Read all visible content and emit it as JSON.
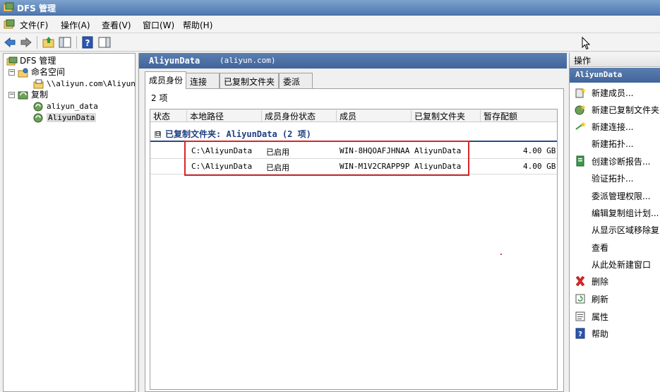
{
  "window": {
    "title": "DFS 管理",
    "icon": "dfs-management-icon"
  },
  "menu": [
    "文件(F)",
    "操作(A)",
    "查看(V)",
    "窗口(W)",
    "帮助(H)"
  ],
  "toolbar": {
    "buttons": [
      "back-arrow-icon",
      "forward-arrow-icon",
      "up-folder-icon",
      "show-hide-tree-icon",
      "help-icon",
      "action-pane-icon"
    ]
  },
  "tree": {
    "root": "DFS 管理",
    "namespace": "命名空间",
    "namespace_item": "\\\\aliyun.com\\AliyunDa",
    "replication": "复制",
    "groups": [
      "aliyun_data",
      "AliyunData"
    ]
  },
  "center": {
    "header_title": "AliyunData",
    "header_domain": "(aliyun.com)",
    "tabs": [
      "成员身份",
      "连接",
      "已复制文件夹",
      "委派"
    ],
    "count_text": "2 项",
    "columns": [
      "状态",
      "本地路径",
      "成员身份状态",
      "成员",
      "已复制文件夹",
      "暂存配额"
    ],
    "group_label": "已复制文件夹: AliyunData (2 项)",
    "group_toggle": "⊟",
    "rows": [
      {
        "status": "",
        "path": "C:\\AliyunData",
        "state": "已启用",
        "member": "WIN-8HQOAFJHNAA",
        "folder": "AliyunData",
        "quota": "4.00 GB"
      },
      {
        "status": "",
        "path": "C:\\AliyunData",
        "state": "已启用",
        "member": "WIN-M1V2CRAPP9P",
        "folder": "AliyunData",
        "quota": "4.00 GB"
      }
    ]
  },
  "actions": {
    "title": "操作",
    "subtitle": "AliyunData",
    "items": [
      {
        "label": "新建成员...",
        "icon": "new-member-icon"
      },
      {
        "label": "新建已复制文件夹",
        "icon": "new-replicated-folder-icon"
      },
      {
        "label": "新建连接...",
        "icon": "new-connection-icon"
      },
      {
        "label": "新建拓扑...",
        "icon": ""
      },
      {
        "label": "创建诊断报告...",
        "icon": "diagnostic-report-icon"
      },
      {
        "label": "验证拓扑...",
        "icon": ""
      },
      {
        "label": "委派管理权限...",
        "icon": ""
      },
      {
        "label": "编辑复制组计划...",
        "icon": ""
      },
      {
        "label": "从显示区域移除复",
        "icon": ""
      },
      {
        "label": "查看",
        "icon": ""
      },
      {
        "label": "从此处新建窗口",
        "icon": ""
      },
      {
        "label": "删除",
        "icon": "delete-icon"
      },
      {
        "label": "刷新",
        "icon": "refresh-icon"
      },
      {
        "label": "属性",
        "icon": "properties-icon"
      },
      {
        "label": "帮助",
        "icon": "help-icon"
      }
    ]
  },
  "colors": {
    "header_blue": "#41659b",
    "highlight_red": "#d82626"
  }
}
